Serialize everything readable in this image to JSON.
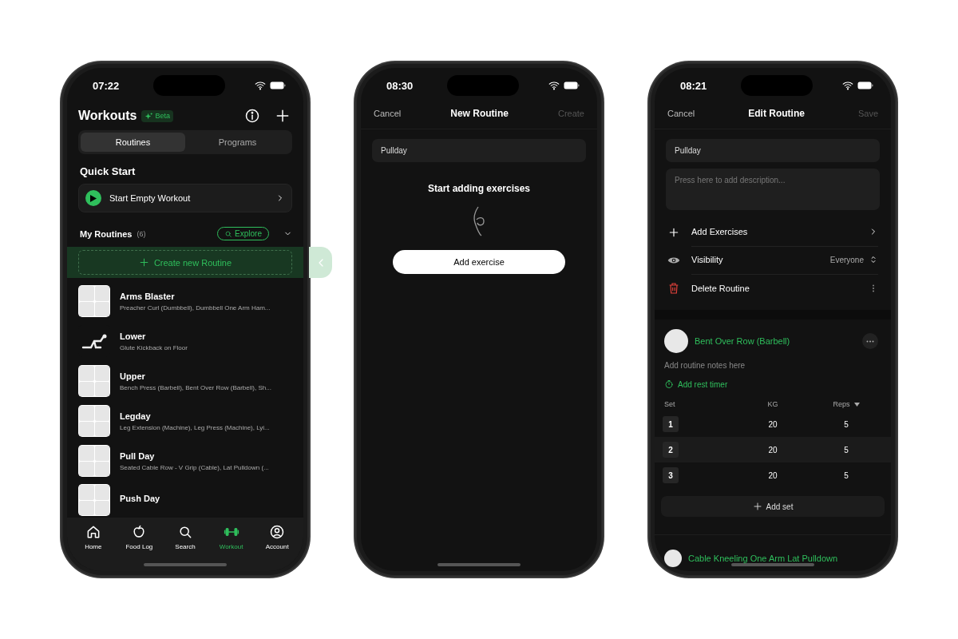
{
  "workouts_screen": {
    "status_time": "07:22",
    "title": "Workouts",
    "badge": "Beta",
    "tabs": [
      {
        "label": "Routines",
        "selected": true
      },
      {
        "label": "Programs",
        "selected": false
      }
    ],
    "quick_start": {
      "title": "Quick Start",
      "action": "Start Empty Workout"
    },
    "routines_header": {
      "title": "My Routines",
      "count": "(6)",
      "explore": "Explore"
    },
    "create_button": "Create new Routine",
    "routines": [
      {
        "name": "Arms Blaster",
        "exercises": "Preacher Curl (Dumbbell), Dumbbell One Arm Ham...",
        "kind": "grid"
      },
      {
        "name": "Lower",
        "exercises": "Glute Kickback on Floor",
        "kind": "single"
      },
      {
        "name": "Upper",
        "exercises": "Bench Press (Barbell), Bent Over Row (Barbell), Sh...",
        "kind": "grid"
      },
      {
        "name": "Legday",
        "exercises": "Leg Extension (Machine), Leg Press (Machine), Lyi...",
        "kind": "grid"
      },
      {
        "name": "Pull Day",
        "exercises": "Seated Cable Row - V Grip (Cable), Lat Pulldown (...",
        "kind": "grid"
      },
      {
        "name": "Push Day",
        "kind": "grid"
      }
    ],
    "nav": [
      {
        "label": "Home",
        "kind": "home",
        "selected": false
      },
      {
        "label": "Food Log",
        "kind": "food",
        "selected": false
      },
      {
        "label": "Search",
        "kind": "search",
        "selected": false
      },
      {
        "label": "Workout",
        "kind": "workout",
        "selected": true
      },
      {
        "label": "Account",
        "kind": "account",
        "selected": false
      }
    ]
  },
  "new_routine_screen": {
    "status_time": "08:30",
    "cancel": "Cancel",
    "title": "New Routine",
    "confirm": "Create",
    "confirm_disabled": true,
    "name_value": "Pullday",
    "empty_title": "Start adding exercises",
    "add_button": "Add exercise"
  },
  "edit_routine_screen": {
    "status_time": "08:21",
    "cancel": "Cancel",
    "title": "Edit Routine",
    "confirm": "Save",
    "confirm_disabled": true,
    "name_value": "Pullday",
    "description_placeholder": "Press here to add description...",
    "options": [
      {
        "label": "Add Exercises",
        "kind": "add"
      },
      {
        "label": "Visibility",
        "kind": "visibility",
        "value": "Everyone"
      },
      {
        "label": "Delete Routine",
        "kind": "delete"
      }
    ],
    "exercise": {
      "name": "Bent Over Row (Barbell)",
      "notes_placeholder": "Add routine notes here",
      "rest_timer": "Add rest timer",
      "columns": [
        "Set",
        "KG",
        "Reps"
      ],
      "sets": [
        {
          "set": "1",
          "kg": "20",
          "reps": "5"
        },
        {
          "set": "2",
          "kg": "20",
          "reps": "5"
        },
        {
          "set": "3",
          "kg": "20",
          "reps": "5"
        }
      ],
      "add_set": "Add set"
    },
    "next_exercise": "Cable Kneeling One Arm Lat Pulldown"
  }
}
